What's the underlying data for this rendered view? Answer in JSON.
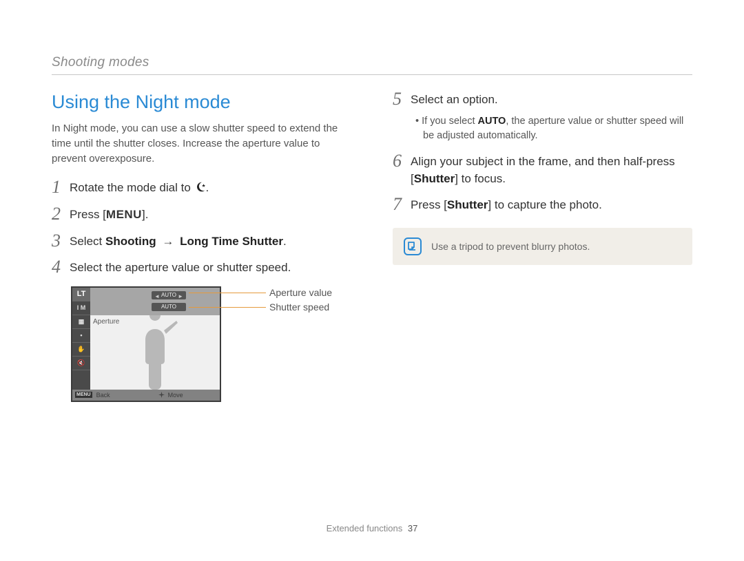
{
  "breadcrumb": "Shooting modes",
  "title": "Using the Night mode",
  "intro": "In Night mode, you can use a slow shutter speed to extend the time until the shutter closes. Increase the aperture value to prevent overexposure.",
  "steps_left": [
    {
      "num": "1",
      "parts": [
        {
          "t": "plain",
          "v": "Rotate the mode dial to "
        },
        {
          "t": "moonicon"
        },
        {
          "t": "plain",
          "v": "."
        }
      ]
    },
    {
      "num": "2",
      "parts": [
        {
          "t": "plain",
          "v": "Press ["
        },
        {
          "t": "menukey",
          "v": "MENU"
        },
        {
          "t": "plain",
          "v": "]."
        }
      ]
    },
    {
      "num": "3",
      "parts": [
        {
          "t": "plain",
          "v": "Select "
        },
        {
          "t": "bold",
          "v": "Shooting"
        },
        {
          "t": "plain",
          "v": " "
        },
        {
          "t": "arrow",
          "v": "→"
        },
        {
          "t": "plain",
          "v": " "
        },
        {
          "t": "bold",
          "v": "Long Time Shutter"
        },
        {
          "t": "plain",
          "v": "."
        }
      ]
    },
    {
      "num": "4",
      "parts": [
        {
          "t": "plain",
          "v": "Select the aperture value or shutter speed."
        }
      ]
    }
  ],
  "steps_right": [
    {
      "num": "5",
      "parts": [
        {
          "t": "plain",
          "v": "Select an option."
        }
      ],
      "sub": [
        {
          "t": "plain",
          "v": "If you select "
        },
        {
          "t": "bold",
          "v": "AUTO"
        },
        {
          "t": "plain",
          "v": ", the aperture value or shutter speed will be adjusted automatically."
        }
      ]
    },
    {
      "num": "6",
      "parts": [
        {
          "t": "plain",
          "v": "Align your subject in the frame, and then half-press ["
        },
        {
          "t": "bold",
          "v": "Shutter"
        },
        {
          "t": "plain",
          "v": "] to focus."
        }
      ]
    },
    {
      "num": "7",
      "parts": [
        {
          "t": "plain",
          "v": "Press ["
        },
        {
          "t": "bold",
          "v": "Shutter"
        },
        {
          "t": "plain",
          "v": "] to capture the photo."
        }
      ]
    }
  ],
  "cam": {
    "lt": "LT",
    "side2": "I M",
    "pill1": "AUTO",
    "pill2": "AUTO",
    "aperture_label": "Aperture",
    "menu": "MENU",
    "back": "Back",
    "move": "Move"
  },
  "callouts": {
    "aperture": "Aperture value",
    "shutter": "Shutter speed"
  },
  "note": "Use a tripod to prevent blurry photos.",
  "footer_section": "Extended functions",
  "footer_page": "37"
}
